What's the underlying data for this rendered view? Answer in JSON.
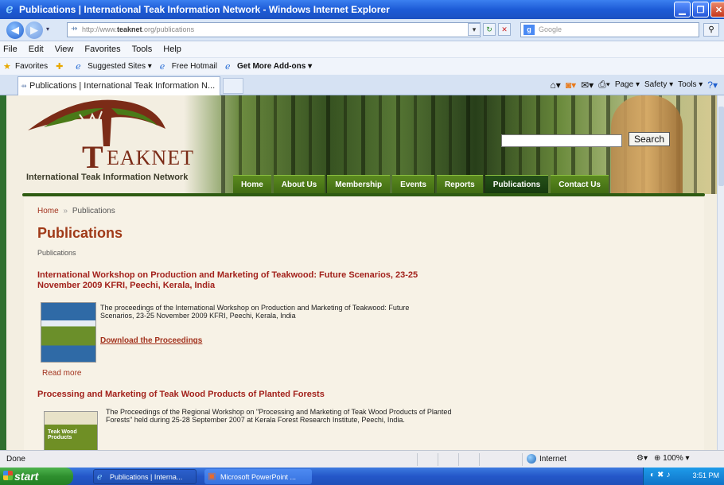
{
  "browser": {
    "title": "Publications | International Teak Information Network - Windows Internet Explorer",
    "address": "http://www.teaknet.org/publications",
    "address_pre": "http://www.",
    "address_host": "teaknet",
    "address_post": ".org/publications",
    "search_placeholder": "Google",
    "menu": [
      "File",
      "Edit",
      "View",
      "Favorites",
      "Tools",
      "Help"
    ],
    "favorites_label": "Favorites",
    "fav_links": [
      "Suggested Sites ▾",
      "Free Hotmail",
      "Get More Add-ons ▾"
    ],
    "tab_title": "Publications | International Teak Information N...",
    "cmd": {
      "page": "Page ▾",
      "safety": "Safety ▾",
      "tools": "Tools ▾"
    }
  },
  "site": {
    "logo_letter": "T",
    "logo_text": "EAKNET",
    "logo_sub": "International Teak Information Network",
    "search_button": "Search",
    "nav": [
      "Home",
      "About Us",
      "Membership",
      "Events",
      "Reports",
      "Publications",
      "Contact Us"
    ],
    "active_nav": "Publications"
  },
  "page": {
    "breadcrumb_home": "Home",
    "breadcrumb_sep": "»",
    "breadcrumb_current": "Publications",
    "title": "Publications",
    "subtitle": "Publications",
    "articles": [
      {
        "title": "International Workshop on Production and Marketing of Teakwood: Future Scenarios, 23-25 November 2009 KFRI, Peechi, Kerala, India",
        "body": "The proceedings of the International Workshop on Production and Marketing of Teakwood: Future Scenarios, 23-25 November 2009 KFRI, Peechi, Kerala, India",
        "download": "Download the Proceedings",
        "readmore": "Read more"
      },
      {
        "title": "Processing and Marketing of Teak Wood Products of Planted Forests",
        "body": "The Proceedings of the Regional Workshop on \"Processing and Marketing of Teak Wood Products of Planted Forests\" held during 25-28 September 2007 at Kerala Forest Research Institute, Peechi, India.",
        "cover_text": "Teak Wood Products"
      }
    ]
  },
  "status": {
    "text": "Done",
    "zone": "Internet",
    "zoom": "⊕ 100% ▾"
  },
  "taskbar": {
    "start": "start",
    "items": [
      "Publications | Interna...",
      "Microsoft PowerPoint ..."
    ],
    "clock": "3:51 PM"
  },
  "colors": {
    "accent_red": "#a2321d",
    "nav_green": "#4a7a18",
    "nav_active": "#1d4412"
  }
}
